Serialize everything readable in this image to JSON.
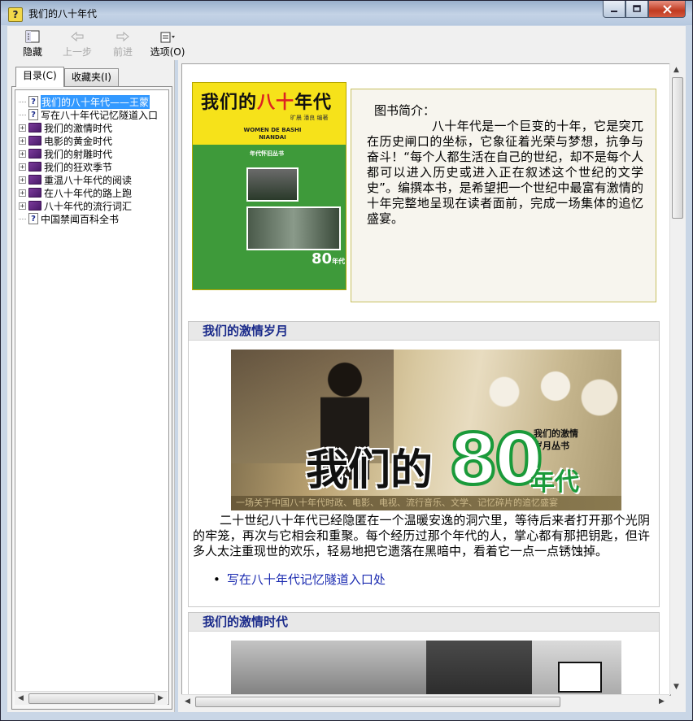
{
  "window": {
    "title": "我们的八十年代",
    "icon": "help-file-icon"
  },
  "toolbar": {
    "hide": "隐藏",
    "back": "上一步",
    "forward": "前进",
    "options": "选项(O)"
  },
  "tabs": {
    "contents": "目录(C)",
    "favorites": "收藏夹(I)"
  },
  "tree": [
    {
      "label": "我们的八十年代——王蒙",
      "icon": "topic",
      "expandable": false,
      "selected": true
    },
    {
      "label": "写在八十年代记忆隧道入口",
      "icon": "topic",
      "expandable": false,
      "selected": false
    },
    {
      "label": "我们的激情时代",
      "icon": "book",
      "expandable": true,
      "selected": false
    },
    {
      "label": "电影的黄金时代",
      "icon": "book",
      "expandable": true,
      "selected": false
    },
    {
      "label": "我们的射雕时代",
      "icon": "book",
      "expandable": true,
      "selected": false
    },
    {
      "label": "我们的狂欢季节",
      "icon": "book",
      "expandable": true,
      "selected": false
    },
    {
      "label": "重温八十年代的阅读",
      "icon": "book",
      "expandable": true,
      "selected": false
    },
    {
      "label": "在八十年代的路上跑",
      "icon": "book",
      "expandable": true,
      "selected": false
    },
    {
      "label": "八十年代的流行词汇",
      "icon": "book",
      "expandable": true,
      "selected": false
    },
    {
      "label": "中国禁闻百科全书",
      "icon": "topic",
      "expandable": false,
      "selected": false
    }
  ],
  "cover": {
    "title_black1": "我们的",
    "title_red": "八十",
    "title_black2": "年代",
    "authors": "旷晨 潘良 编著",
    "pinyin": "WOMEN DE BASHI NIANDAI",
    "series": "年代怀旧丛书",
    "badge_num": "80",
    "badge_unit": "年代"
  },
  "intro": {
    "heading": "图书简介：",
    "text": "八十年代是一个巨变的十年，它是突兀在历史闸口的坐标，它象征着光荣与梦想，抗争与奋斗！“每个人都生活在自己的世纪，却不是每个人都可以进入历史或进入正在叙述这个世纪的文学史”。编撰本书，是希望把一个世纪中最富有激情的十年完整地呈现在读者面前，完成一场集体的追忆盛宴。"
  },
  "section1": {
    "title": "我们的激情岁月",
    "banner": {
      "main": "我们的",
      "num": "80",
      "suffix": "年代",
      "series": "我们的激情岁月丛书",
      "strip": "一场关于中国八十年代时政、电影、电视、流行音乐、文学、记忆碎片的追忆盛宴"
    },
    "text": "二十世纪八十年代已经隐匿在一个温暖安逸的洞穴里，等待后来者打开那个光阴的牢笼，再次与它相会和重聚。每个经历过那个年代的人，掌心都有那把钥匙，但许多人太注重现世的欢乐，轻易地把它遗落在黑暗中，看着它一点一点锈蚀掉。",
    "link": "写在八十年代记忆隧道入口处"
  },
  "section2": {
    "title": "我们的激情时代"
  }
}
